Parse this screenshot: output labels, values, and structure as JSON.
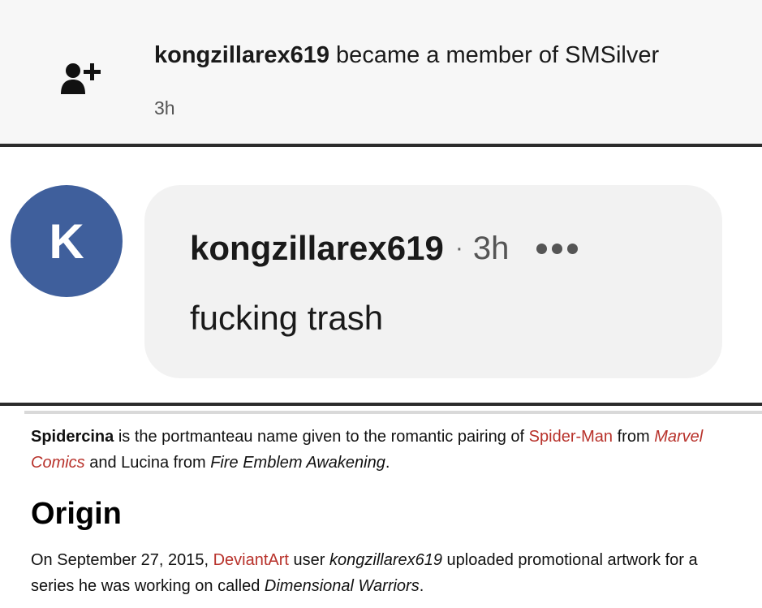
{
  "notification": {
    "icon": "user-plus-icon",
    "username": "kongzillarex619",
    "action": " became a member of SMSilver",
    "time": "3h"
  },
  "comment": {
    "avatar_letter": "K",
    "avatar_color": "#3f5f9c",
    "username": "kongzillarex619",
    "separator": "·",
    "time": "3h",
    "more_icon": "more-dots-icon",
    "body": "fucking trash"
  },
  "article": {
    "intro": {
      "subject": "Spidercina",
      "t1": " is the portmanteau name given to the romantic pairing of ",
      "link_spiderman": "Spider-Man",
      "t2": " from ",
      "link_marvel": "Marvel Comics",
      "t3": " and Lucina from ",
      "fire_emblem": "Fire Emblem Awakening",
      "t4": "."
    },
    "heading": "Origin",
    "origin": {
      "t1": "On September 27, 2015, ",
      "link_deviantart": "DeviantArt",
      "t2": " user ",
      "user": "kongzillarex619",
      "t3": " uploaded promotional artwork for a series he was working on called ",
      "series": "Dimensional Warriors",
      "t4": "."
    },
    "link_color": "#b8322b"
  }
}
